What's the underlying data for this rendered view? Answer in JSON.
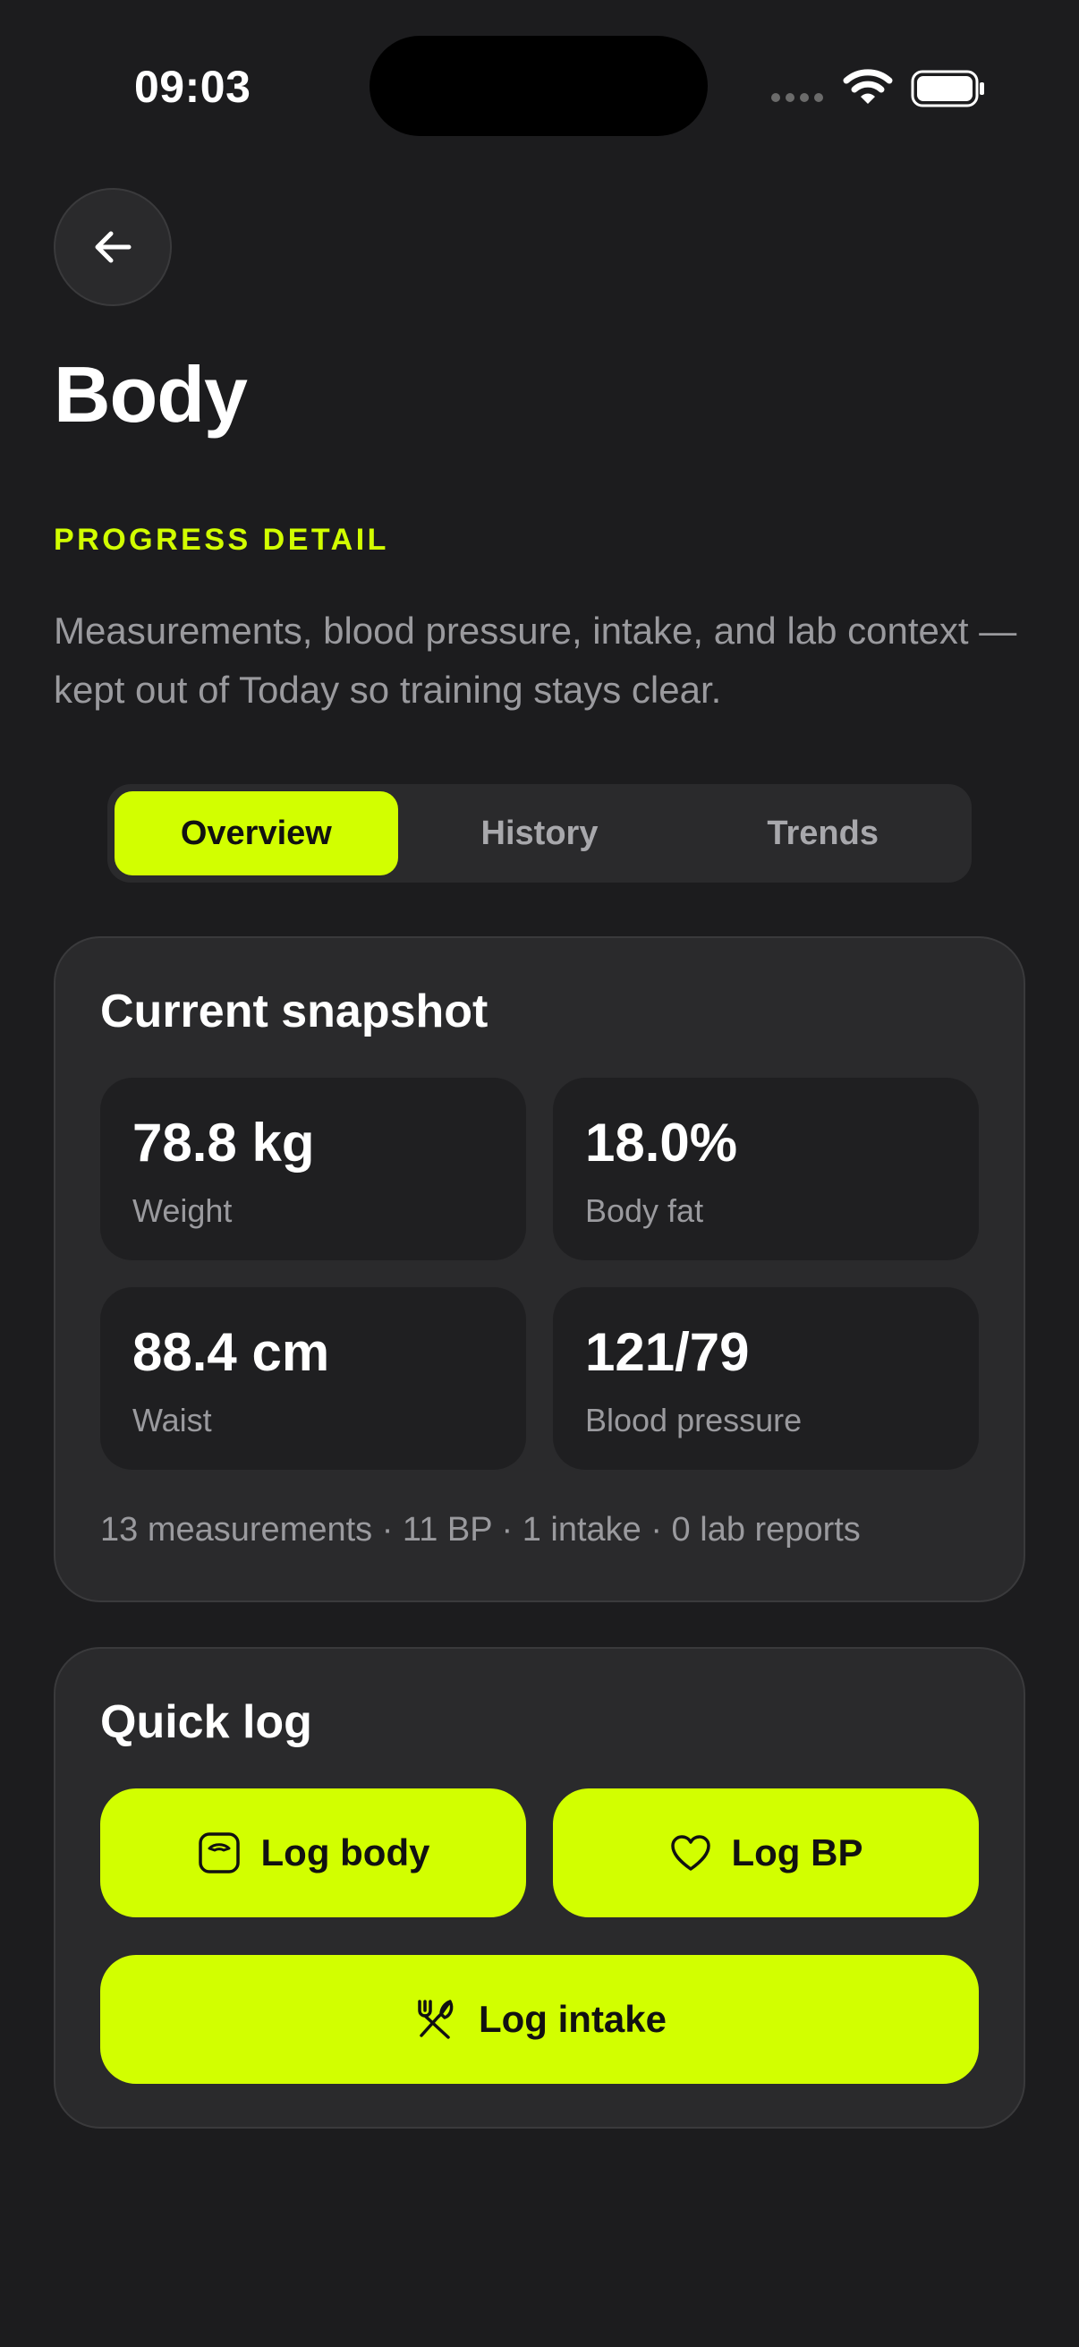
{
  "status_bar": {
    "time": "09:03"
  },
  "header": {
    "title": "Body",
    "eyebrow": "PROGRESS DETAIL",
    "description": "Measurements, blood pressure, intake, and lab context — kept out of Today so training stays clear."
  },
  "tabs": [
    {
      "label": "Overview",
      "active": true
    },
    {
      "label": "History",
      "active": false
    },
    {
      "label": "Trends",
      "active": false
    }
  ],
  "snapshot": {
    "title": "Current snapshot",
    "stats": [
      {
        "value": "78.8 kg",
        "label": "Weight"
      },
      {
        "value": "18.0%",
        "label": "Body fat"
      },
      {
        "value": "88.4 cm",
        "label": "Waist"
      },
      {
        "value": "121/79",
        "label": "Blood pressure"
      }
    ],
    "summary": "13 measurements · 11 BP · 1 intake · 0 lab reports"
  },
  "quick_log": {
    "title": "Quick log",
    "buttons": [
      {
        "label": "Log body",
        "icon": "scale-icon"
      },
      {
        "label": "Log BP",
        "icon": "heart-icon"
      },
      {
        "label": "Log intake",
        "icon": "utensils-icon"
      }
    ]
  },
  "colors": {
    "accent": "#d2ff00",
    "background": "#1c1c1e",
    "card": "#2a2a2c"
  }
}
